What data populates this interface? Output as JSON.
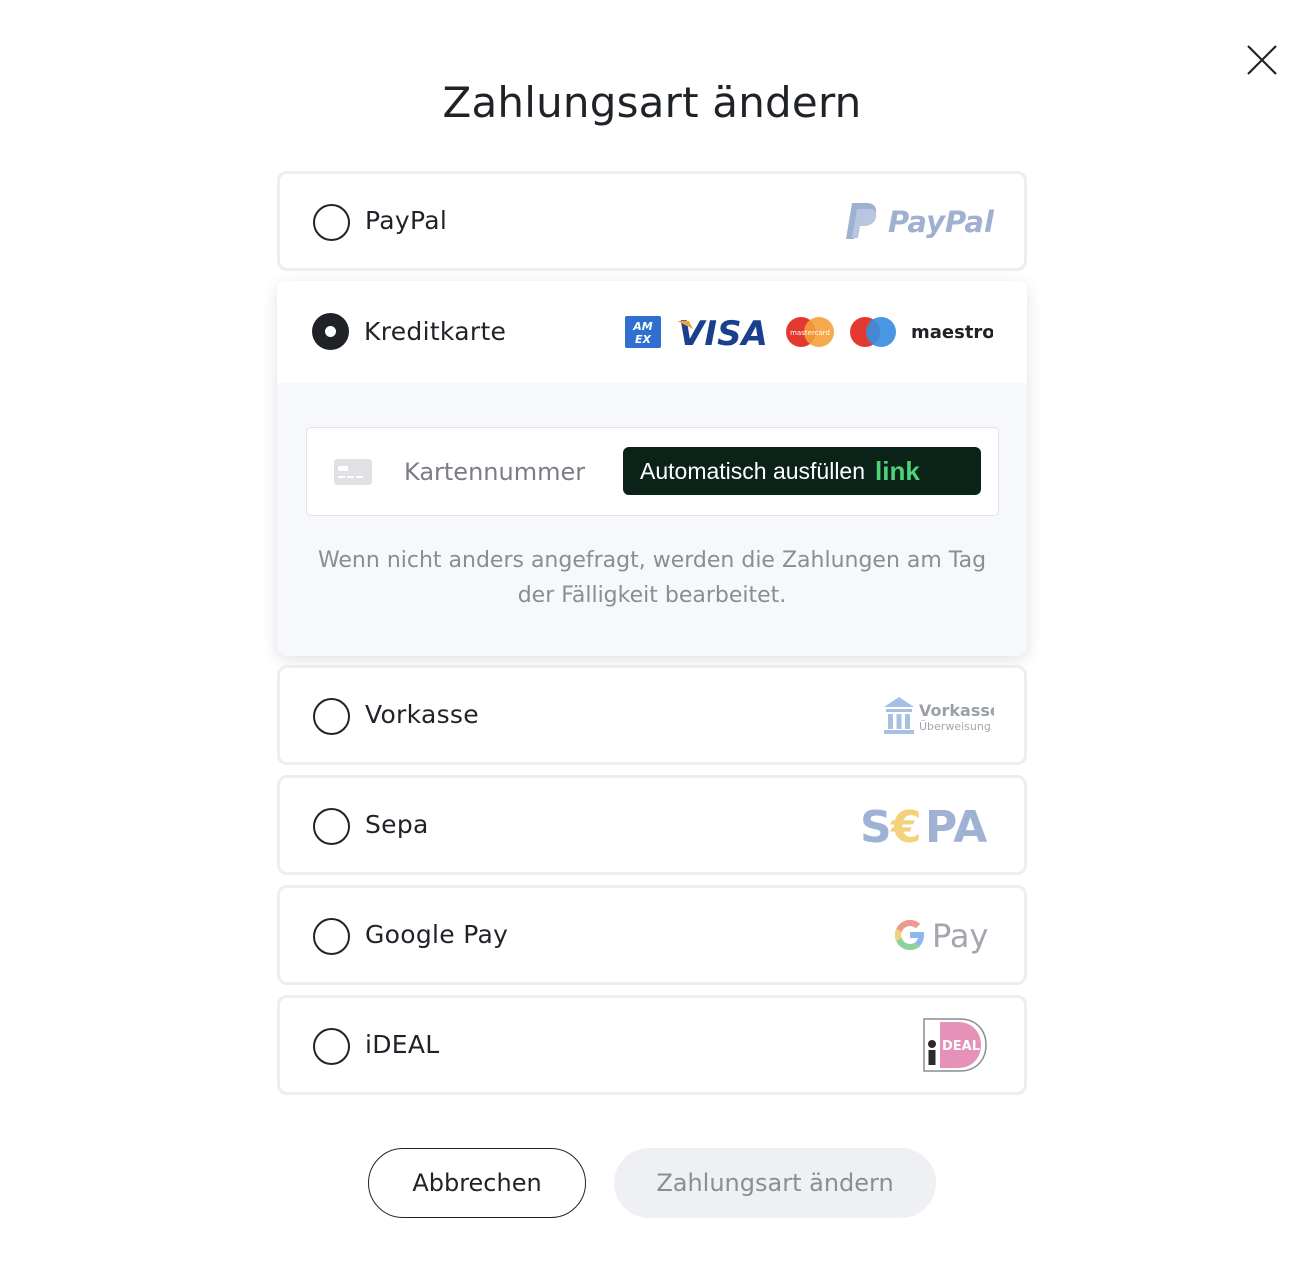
{
  "dialog": {
    "title": "Zahlungsart ändern",
    "close_icon": "close-icon"
  },
  "methods": [
    {
      "id": "paypal",
      "label": "PayPal",
      "selected": false,
      "logo_text": "PayPal"
    },
    {
      "id": "kreditkarte",
      "label": "Kreditkarte",
      "selected": true,
      "logos": [
        "AMEX",
        "VISA",
        "mastercard",
        "maestro"
      ]
    },
    {
      "id": "vorkasse",
      "label": "Vorkasse",
      "selected": false,
      "logo_text": "Vorkasse",
      "logo_subtext": "Überweisung"
    },
    {
      "id": "sepa",
      "label": "Sepa",
      "selected": false,
      "logo_text": "SEPA"
    },
    {
      "id": "googlepay",
      "label": "Google Pay",
      "selected": false,
      "logo_text": "Pay"
    },
    {
      "id": "ideal",
      "label": "iDEAL",
      "selected": false,
      "logo_text": "iDEAL"
    }
  ],
  "card_form": {
    "card_number_placeholder": "Kartennummer",
    "autofill_label": "Automatisch ausfüllen",
    "autofill_brand": "link",
    "hint": "Wenn nicht anders angefragt, werden die Zahlungen am Tag der Fälligkeit bearbeitet."
  },
  "actions": {
    "cancel_label": "Abbrechen",
    "submit_label": "Zahlungsart ändern"
  },
  "colors": {
    "selected_radio": "#1f2328",
    "autofill_bg": "#0a2218",
    "link_green": "#4fd37a",
    "submit_disabled_bg": "#eef0f3"
  }
}
